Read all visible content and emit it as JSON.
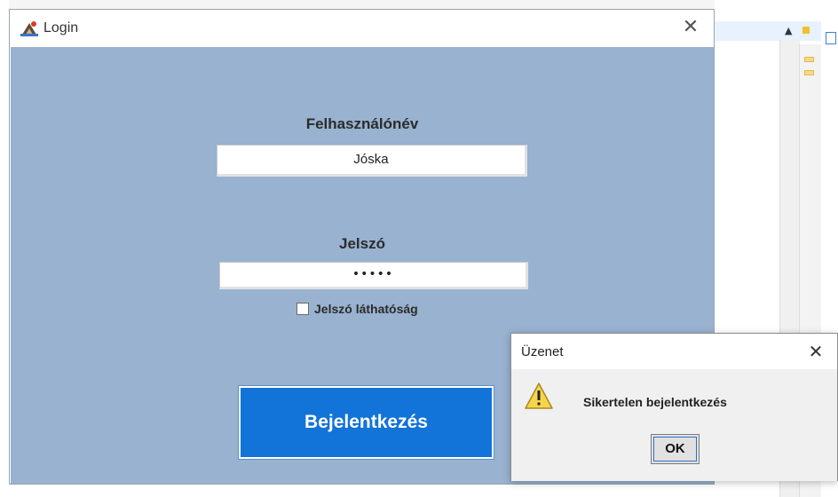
{
  "login_window": {
    "title": "Login",
    "close_glyph": "✕",
    "username_label": "Felhasználónév",
    "username_value": "Jóska",
    "password_label": "Jelszó",
    "password_masked": "•••••",
    "show_password_label": "Jelszó láthatóság",
    "show_password_checked": false,
    "login_button_label": "Bejelentkezés",
    "colors": {
      "body_bg": "#98b2d0",
      "button_bg": "#1273d8",
      "button_text": "#ffffff"
    }
  },
  "message_dialog": {
    "title": "Üzenet",
    "close_glyph": "✕",
    "message": "Sikertelen bejelentkezés",
    "ok_label": "OK",
    "icon": "warning-icon"
  }
}
